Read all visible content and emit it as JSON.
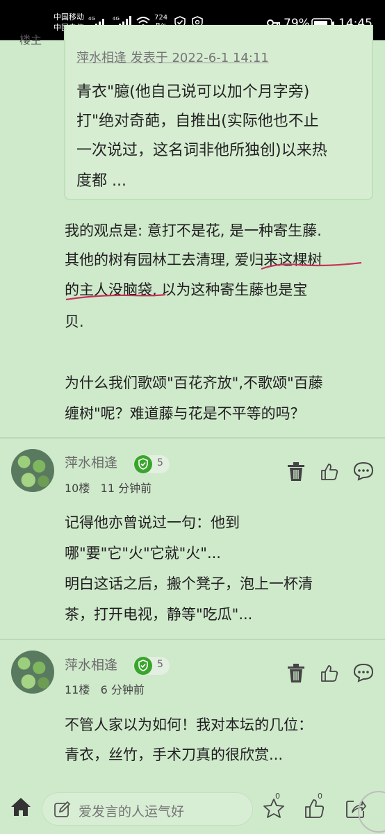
{
  "status_bar": {
    "carrier1": "中国移动",
    "carrier2": "中国电信",
    "net1": "4G",
    "net2": "4G",
    "speed_value": "724",
    "speed_unit": "B/s",
    "battery": "79%",
    "time": "14:45"
  },
  "op_label": "楼主",
  "quote": {
    "meta": "萍水相逢 发表于 2022-6-1 14:11",
    "lines": [
      "青衣\"臆(他自己说可以加个月字旁)",
      "打\"绝对奇葩，自推出(实际他也不止",
      "一次说过，这名词非他所独创)以来热",
      "度都 ..."
    ]
  },
  "post": {
    "lines": [
      "我的观点是: 意打不是花, 是一种寄生藤.",
      "其他的树有园林工去清理, 爱归来这棵树",
      "的主人没脑袋, 以为这种寄生藤也是宝",
      "贝.",
      "为什么我们歌颂\"百花齐放\",不歌颂\"百藤",
      "缠树\"呢？难道藤与花是不平等的吗？"
    ]
  },
  "replies": [
    {
      "username": "萍水相逢",
      "level": "5",
      "floor": "10楼",
      "time": "11 分钟前",
      "lines": [
        "记得他亦曾说过一句：他到",
        "哪\"要\"它\"火\"它就\"火\"...",
        "明白这话之后，搬个凳子，泡上一杯清",
        "茶，打开电视，静等\"吃瓜\"..."
      ]
    },
    {
      "username": "萍水相逢",
      "level": "5",
      "floor": "11楼",
      "time": "6 分钟前",
      "lines": [
        "不管人家以为如何！我对本坛的几位：",
        "青衣，丝竹，手术刀真的很欣赏..."
      ]
    }
  ],
  "bottom_bar": {
    "placeholder": "爱发言的人运气好",
    "favorite_count": "0",
    "like_count": "0"
  },
  "colors": {
    "background": "#cfe9cb",
    "underline_annotation": "#c8325c",
    "level_badge": "#3aa52c"
  }
}
